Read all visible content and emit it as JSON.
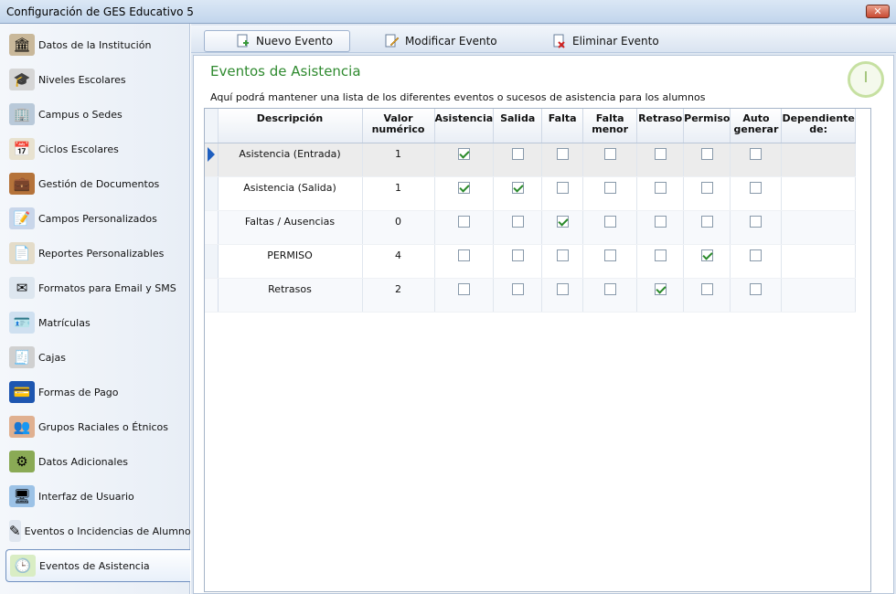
{
  "window": {
    "title": "Configuración de GES Educativo 5",
    "close_label": "✕"
  },
  "sidebar": {
    "items": [
      {
        "label": "Datos de la Institución",
        "icon": "building-icon",
        "active": false
      },
      {
        "label": "Niveles Escolares",
        "icon": "graduation-cap-icon",
        "active": false
      },
      {
        "label": "Campus o Sedes",
        "icon": "campus-icon",
        "active": false
      },
      {
        "label": "Ciclos Escolares",
        "icon": "calendar-icon",
        "active": false
      },
      {
        "label": "Gestión de Documentos",
        "icon": "briefcase-icon",
        "active": false
      },
      {
        "label": "Campos Personalizados",
        "icon": "custom-fields-icon",
        "active": false
      },
      {
        "label": "Reportes Personalizables",
        "icon": "report-icon",
        "active": false
      },
      {
        "label": "Formatos para Email y SMS",
        "icon": "envelope-icon",
        "active": false
      },
      {
        "label": "Matrículas",
        "icon": "id-card-icon",
        "active": false
      },
      {
        "label": "Cajas",
        "icon": "cash-register-icon",
        "active": false
      },
      {
        "label": "Formas de Pago",
        "icon": "card-payment-icon",
        "active": false
      },
      {
        "label": "Grupos Raciales o Étnicos",
        "icon": "people-icon",
        "active": false
      },
      {
        "label": "Datos Adicionales",
        "icon": "gear-icon",
        "active": false
      },
      {
        "label": "Interfaz de Usuario",
        "icon": "monitor-icon",
        "active": false
      },
      {
        "label": "Eventos o Incidencias de Alumnos",
        "icon": "pen-icon",
        "active": false
      },
      {
        "label": "Eventos de Asistencia",
        "icon": "clock-icon",
        "active": true
      }
    ]
  },
  "toolbar": {
    "new_label": "Nuevo Evento",
    "edit_label": "Modificar Evento",
    "delete_label": "Eliminar Evento"
  },
  "section": {
    "title": "Eventos de Asistencia",
    "description": "Aquí podrá mantener una lista de los diferentes eventos o sucesos de asistencia para los alumnos"
  },
  "grid": {
    "columns": [
      {
        "key": "descripcion",
        "line1": "Descripción",
        "line2": ""
      },
      {
        "key": "valor",
        "line1": "Valor",
        "line2": "numérico"
      },
      {
        "key": "asistencia",
        "line1": "Asistencia",
        "line2": ""
      },
      {
        "key": "salida",
        "line1": "Salida",
        "line2": ""
      },
      {
        "key": "falta",
        "line1": "Falta",
        "line2": ""
      },
      {
        "key": "falta_menor",
        "line1": "Falta",
        "line2": "menor"
      },
      {
        "key": "retraso",
        "line1": "Retraso",
        "line2": ""
      },
      {
        "key": "permiso",
        "line1": "Permiso",
        "line2": ""
      },
      {
        "key": "auto",
        "line1": "Auto",
        "line2": "generar"
      },
      {
        "key": "dependiente",
        "line1": "Dependiente",
        "line2": "de:"
      }
    ],
    "rows": [
      {
        "descripcion": "Asistencia (Entrada)",
        "valor": "1",
        "asistencia": true,
        "salida": false,
        "falta": false,
        "falta_menor": false,
        "retraso": false,
        "permiso": false,
        "auto": false,
        "dependiente": ""
      },
      {
        "descripcion": "Asistencia (Salida)",
        "valor": "1",
        "asistencia": true,
        "salida": true,
        "falta": false,
        "falta_menor": false,
        "retraso": false,
        "permiso": false,
        "auto": false,
        "dependiente": ""
      },
      {
        "descripcion": "Faltas / Ausencias",
        "valor": "0",
        "asistencia": false,
        "salida": false,
        "falta": true,
        "falta_menor": false,
        "retraso": false,
        "permiso": false,
        "auto": false,
        "dependiente": ""
      },
      {
        "descripcion": "PERMISO",
        "valor": "4",
        "asistencia": false,
        "salida": false,
        "falta": false,
        "falta_menor": false,
        "retraso": false,
        "permiso": true,
        "auto": false,
        "dependiente": ""
      },
      {
        "descripcion": "Retrasos",
        "valor": "2",
        "asistencia": false,
        "salida": false,
        "falta": false,
        "falta_menor": false,
        "retraso": true,
        "permiso": false,
        "auto": false,
        "dependiente": ""
      }
    ],
    "current_row": 0
  }
}
